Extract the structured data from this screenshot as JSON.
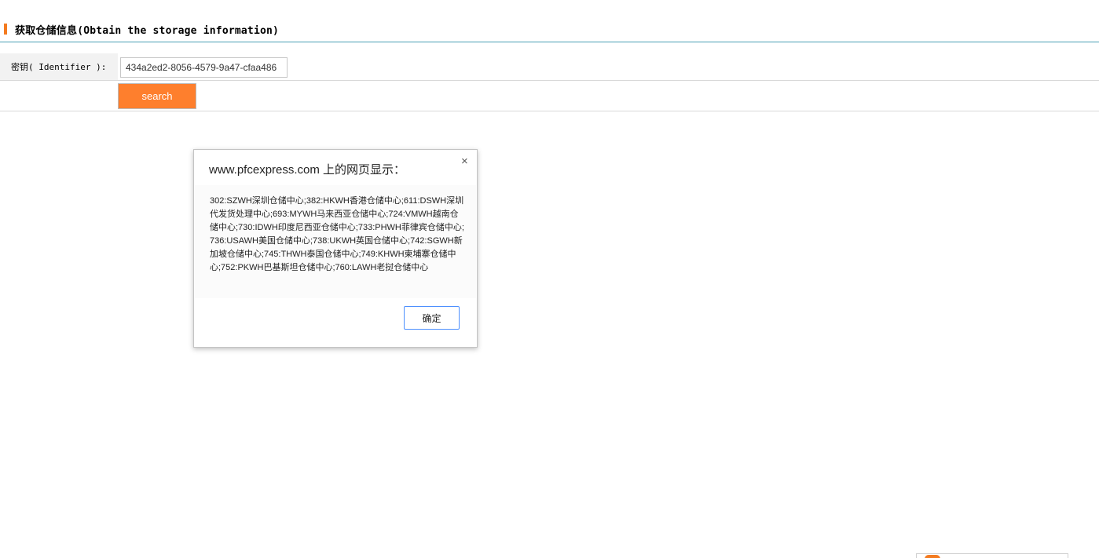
{
  "section": {
    "title": "获取仓储信息(Obtain the storage information)"
  },
  "form": {
    "key_label": "密钥( Identifier ):",
    "key_value": "434a2ed2-8056-4579-9a47-cfaa486",
    "search_label": "search"
  },
  "dialog": {
    "title": "www.pfcexpress.com 上的网页显示：",
    "close_glyph": "×",
    "message": "302:SZWH深圳仓储中心;382:HKWH香港仓储中心;611:DSWH深圳代发货处理中心;693:MYWH马来西亚仓储中心;724:VMWH越南仓储中心;730:IDWH印度尼西亚仓储中心;733:PHWH菲律宾仓储中心;736:USAWH美国仓储中心;738:UKWH英国仓储中心;742:SGWH新加坡仓储中心;745:THWH泰国仓储中心;749:KHWH柬埔寨仓储中心;752:PKWH巴基斯坦仓储中心;760:LAWH老挝仓储中心",
    "ok_label": "确定"
  },
  "colors": {
    "accent": "#f47b20",
    "button": "#fe7f2d",
    "divider": "#4a9fb4",
    "dialog_focus": "#4d90fe"
  }
}
